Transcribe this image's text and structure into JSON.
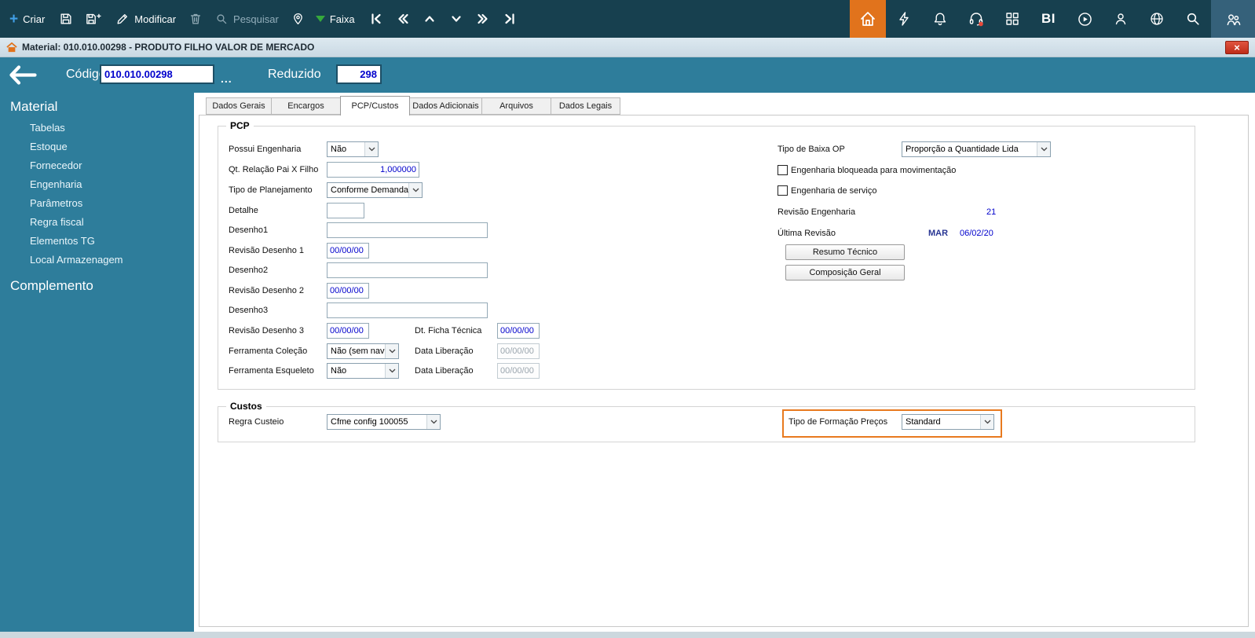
{
  "toolbar": {
    "criar": "Criar",
    "modificar": "Modificar",
    "pesquisar": "Pesquisar",
    "faixa": "Faixa",
    "bi": "BI"
  },
  "titlebar": {
    "title": "Material: 010.010.00298 - PRODUTO FILHO VALOR DE MERCADO"
  },
  "header": {
    "codigo_label": "Código",
    "codigo_value": "010.010.00298",
    "more": "...",
    "reduzido_label": "Reduzido",
    "reduzido_value": "298"
  },
  "sidebar": {
    "material": "Material",
    "items": [
      "Tabelas",
      "Estoque",
      "Fornecedor",
      "Engenharia",
      "Parâmetros",
      "Regra fiscal",
      "Elementos TG",
      "Local Armazenagem"
    ],
    "complemento": "Complemento"
  },
  "tabs": {
    "items": [
      "Dados Gerais",
      "Encargos",
      "PCP/Custos",
      "Dados Adicionais",
      "Arquivos",
      "Dados Legais"
    ],
    "active": "PCP/Custos"
  },
  "pcp": {
    "legend": "PCP",
    "possui_engenharia_label": "Possui Engenharia",
    "possui_engenharia_value": "Não",
    "qt_relacao_label": "Qt. Relação Pai X Filho",
    "qt_relacao_value": "1,000000",
    "tipo_planejamento_label": "Tipo de Planejamento",
    "tipo_planejamento_value": "Conforme Demanda",
    "detalhe_label": "Detalhe",
    "desenho1_label": "Desenho1",
    "revisao1_label": "Revisão Desenho 1",
    "revisao1_value": "00/00/00",
    "desenho2_label": "Desenho2",
    "revisao2_label": "Revisão Desenho 2",
    "revisao2_value": "00/00/00",
    "desenho3_label": "Desenho3",
    "revisao3_label": "Revisão Desenho 3",
    "revisao3_value": "00/00/00",
    "dt_ficha_label": "Dt. Ficha Técnica",
    "dt_ficha_value": "00/00/00",
    "ferramenta_colecao_label": "Ferramenta Coleção",
    "ferramenta_colecao_value": "Não (sem nava",
    "data_liberacao1_label": "Data Liberação",
    "data_liberacao1_value": "00/00/00",
    "ferramenta_esqueleto_label": "Ferramenta Esqueleto",
    "ferramenta_esqueleto_value": "Não",
    "data_liberacao2_label": "Data Liberação",
    "data_liberacao2_value": "00/00/00",
    "tipo_baixa_label": "Tipo de Baixa OP",
    "tipo_baixa_value": "Proporção a Quantidade Lida",
    "chk_bloqueada": "Engenharia bloqueada para movimentação",
    "chk_servico": "Engenharia de serviço",
    "revisao_eng_label": "Revisão Engenharia",
    "revisao_eng_value": "21",
    "ultima_revisao_label": "Última Revisão",
    "ultima_revisao_mes": "MAR",
    "ultima_revisao_data": "06/02/20",
    "btn_resumo": "Resumo Técnico",
    "btn_composicao": "Composição Geral"
  },
  "custos": {
    "legend": "Custos",
    "regra_custeio_label": "Regra Custeio",
    "regra_custeio_value": "Cfme config 100055",
    "tipo_formacao_label": "Tipo de Formação Preços",
    "tipo_formacao_value": "Standard"
  },
  "icons": {
    "plus-icon": "+",
    "close-icon": "×",
    "chevron-down-icon": "⌄",
    "faixa-triangle-icon": "▼"
  },
  "colors": {
    "accent_orange": "#e1731c",
    "toolbar_bg": "#17404f",
    "sidebar_bg": "#2e7d9b",
    "value_blue": "#0000cc",
    "close_red": "#bf2c18"
  }
}
